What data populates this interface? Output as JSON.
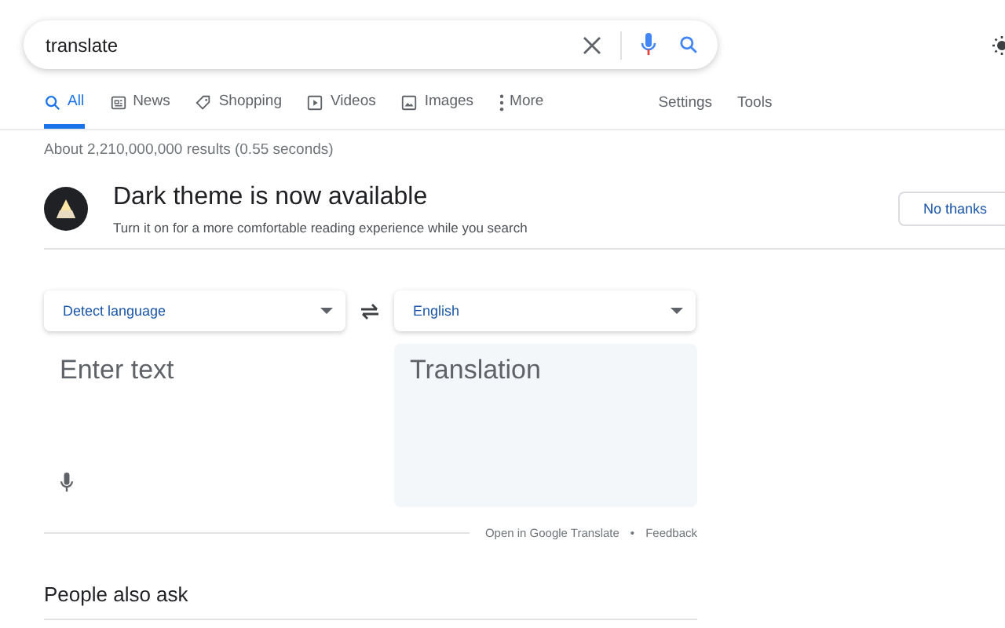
{
  "search": {
    "value": "translate"
  },
  "tabs": [
    {
      "label": "All",
      "kind": "search",
      "selected": true
    },
    {
      "label": "News",
      "kind": "news",
      "selected": false
    },
    {
      "label": "Shopping",
      "kind": "tag",
      "selected": false
    },
    {
      "label": "Videos",
      "kind": "play",
      "selected": false
    },
    {
      "label": "Images",
      "kind": "image",
      "selected": false
    },
    {
      "label": "More",
      "kind": "dots",
      "selected": false
    }
  ],
  "tools": [
    "Settings",
    "Tools"
  ],
  "result_stats": "About 2,210,000,000 results (0.55 seconds)",
  "banner": {
    "title": "Dark theme is now available",
    "text": "Turn it on for a more comfortable reading experience while you search",
    "button": "No thanks"
  },
  "translator": {
    "source_language": "Detect language",
    "target_language": "English",
    "input": {
      "placeholder": "Enter text"
    },
    "output": {
      "placeholder": "Translation"
    },
    "links": [
      "Open in Google Translate",
      "Feedback"
    ],
    "separator": "•"
  },
  "people_also_ask": {
    "title": "People also ask"
  }
}
